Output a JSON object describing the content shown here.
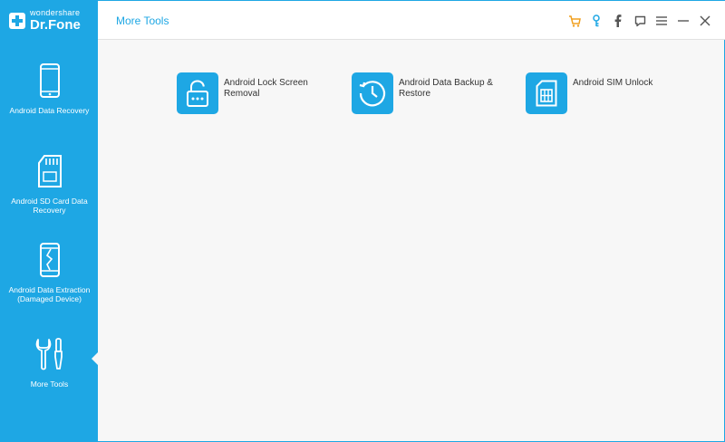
{
  "app": {
    "brand_small": "wondershare",
    "brand_name": "Dr.Fone",
    "accent_color": "#1ea7e4"
  },
  "header": {
    "title": "More Tools",
    "icons": [
      "cart-icon",
      "key-icon",
      "facebook-icon",
      "feedback-icon",
      "menu-icon",
      "minimize-icon",
      "close-icon"
    ]
  },
  "sidebar": {
    "items": [
      {
        "label": "Android Data Recovery",
        "icon": "phone-icon"
      },
      {
        "label": "Android SD Card Data Recovery",
        "icon": "sd-card-icon"
      },
      {
        "label": "Android Data Extraction (Damaged Device)",
        "icon": "broken-phone-icon"
      },
      {
        "label": "More Tools",
        "icon": "tools-icon",
        "active": true
      }
    ]
  },
  "tools": [
    {
      "label": "Android Lock Screen Removal",
      "icon": "lock-icon"
    },
    {
      "label": "Android Data Backup & Restore",
      "icon": "clock-icon"
    },
    {
      "label": "Android SIM Unlock",
      "icon": "sim-card-icon"
    }
  ]
}
